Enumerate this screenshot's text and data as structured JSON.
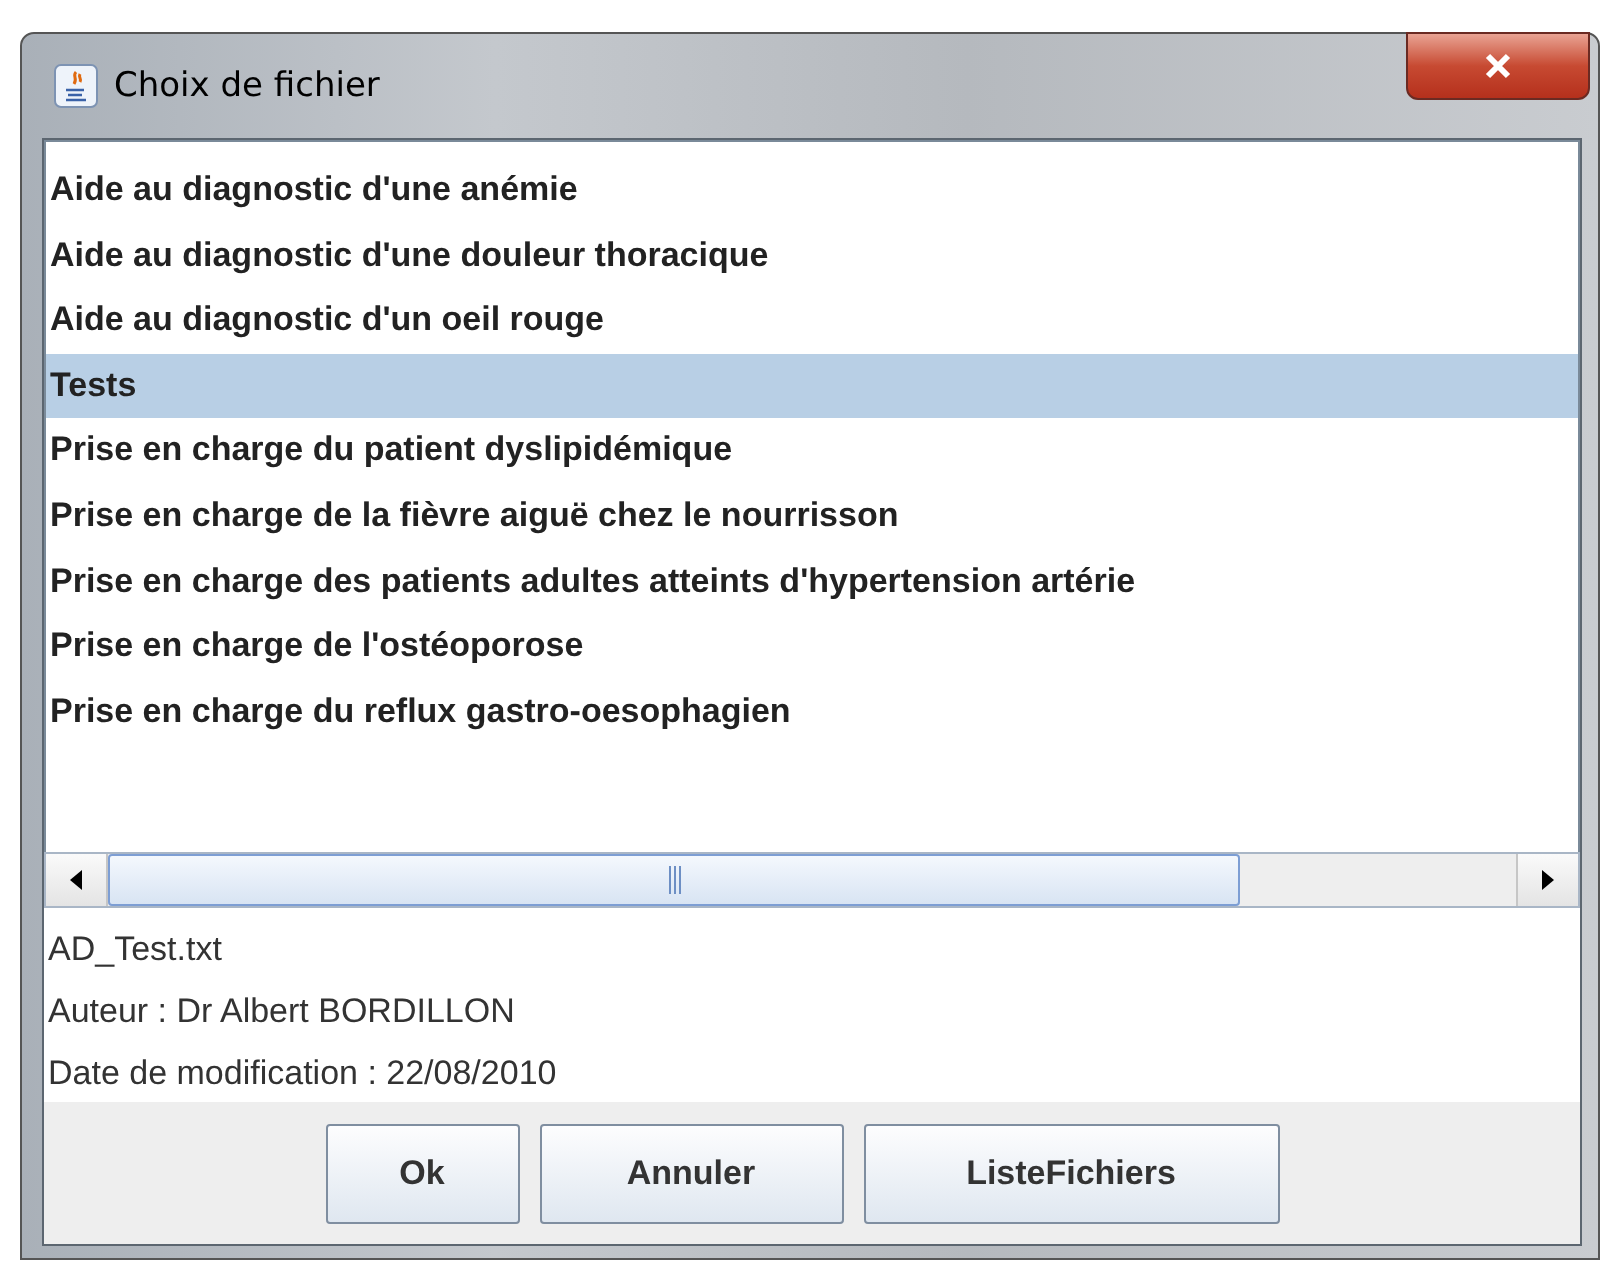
{
  "window": {
    "title": "Choix de fichier"
  },
  "files": [
    {
      "label": "Aide au diagnostic d'une anémie",
      "selected": false
    },
    {
      "label": "Aide au diagnostic d'une douleur thoracique",
      "selected": false
    },
    {
      "label": "Aide au diagnostic d'un oeil rouge",
      "selected": false
    },
    {
      "label": "Tests",
      "selected": true
    },
    {
      "label": "Prise en charge du patient dyslipidémique",
      "selected": false
    },
    {
      "label": "Prise en charge de la fièvre aiguë chez le nourrisson",
      "selected": false
    },
    {
      "label": "Prise en charge des patients adultes atteints d'hypertension artérie",
      "selected": false
    },
    {
      "label": "Prise en charge de l'ostéoporose",
      "selected": false
    },
    {
      "label": "Prise en charge du reflux gastro-oesophagien",
      "selected": false
    }
  ],
  "details": [
    "AD_Test.txt",
    "Auteur : Dr Albert BORDILLON",
    "Date de modification : 22/08/2010"
  ],
  "buttons": [
    "Ok",
    "Annuler",
    "ListeFichiers"
  ]
}
